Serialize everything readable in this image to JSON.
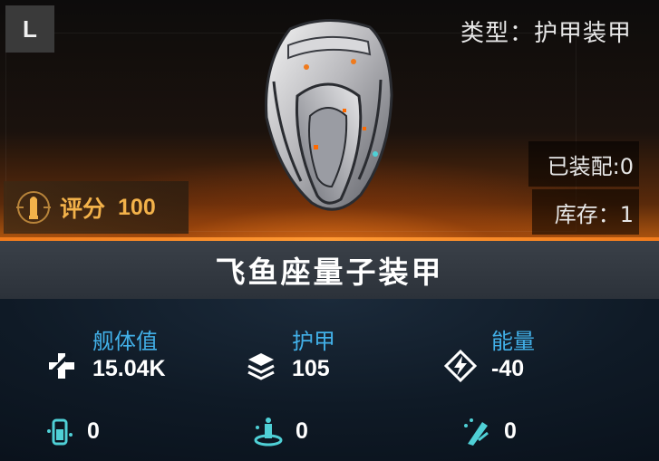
{
  "header": {
    "grade": "L",
    "type_text": "类型：护甲装甲",
    "equipped_text": "已装配:0",
    "stock_text": "库存：1",
    "score_label": "评分",
    "score_value": "100"
  },
  "item": {
    "name": "飞鱼座量子装甲",
    "icon": "armor-module-icon"
  },
  "stats": {
    "hull": {
      "label": "舰体值",
      "value": "15.04K",
      "icon": "hull-cross-icon"
    },
    "armor": {
      "label": "护甲",
      "value": "105",
      "icon": "armor-layers-icon"
    },
    "energy": {
      "label": "能量",
      "value": "-40",
      "icon": "energy-bolt-icon"
    }
  },
  "sub_stats": [
    {
      "icon": "personnel-icon",
      "value": "0"
    },
    {
      "icon": "platform-icon",
      "value": "0"
    },
    {
      "icon": "weapon-icon",
      "value": "0"
    }
  ],
  "colors": {
    "accent_orange": "#f07a1c",
    "score_gold": "#f3b24a",
    "stat_label_blue": "#42b0e8",
    "icon_cyan": "#4fd0d6"
  }
}
